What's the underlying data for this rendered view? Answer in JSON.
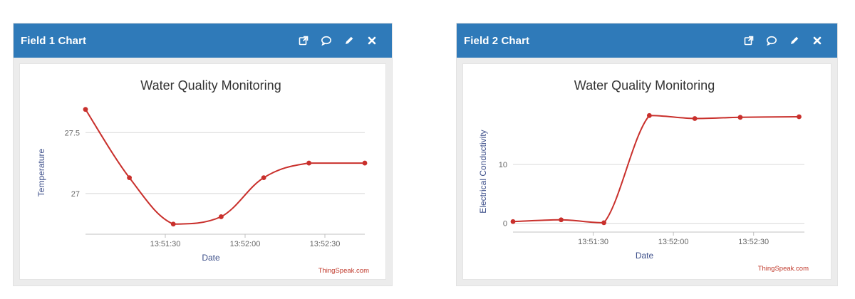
{
  "panels": [
    {
      "title": "Field 1 Chart",
      "tools": [
        "external-link-icon",
        "comment-icon",
        "pencil-icon",
        "close-icon"
      ]
    },
    {
      "title": "Field 2 Chart",
      "tools": [
        "external-link-icon",
        "comment-icon",
        "pencil-icon",
        "close-icon"
      ]
    }
  ],
  "colors": {
    "header": "#2f7ab9",
    "line": "#c9302c",
    "grid": "#d8d8d8"
  },
  "chart_data": [
    {
      "type": "line",
      "title": "Water Quality Monitoring",
      "xlabel": "Date",
      "ylabel": "Temperature",
      "credit": "ThingSpeak.com",
      "x_ticks": [
        "13:51:30",
        "13:52:00",
        "13:52:30"
      ],
      "y_ticks": [
        "27",
        "27.5"
      ],
      "x_tick_values_s": [
        30,
        60,
        90
      ],
      "ylim": [
        26.69,
        27.77
      ],
      "xlim_s": [
        0,
        105
      ],
      "series": [
        {
          "x_s": [
            0,
            16.5,
            33,
            51,
            67,
            84,
            105
          ],
          "values": [
            27.69,
            27.13,
            26.75,
            26.81,
            27.13,
            27.25,
            27.25
          ]
        }
      ],
      "grid": true
    },
    {
      "type": "line",
      "title": "Water Quality Monitoring",
      "xlabel": "Date",
      "ylabel": "Electrical Conductivity",
      "credit": "ThingSpeak.com",
      "x_ticks": [
        "13:51:30",
        "13:52:00",
        "13:52:30"
      ],
      "y_ticks": [
        "0",
        "10"
      ],
      "x_tick_values_s": [
        30,
        60,
        90
      ],
      "ylim": [
        -1.0,
        21.0
      ],
      "xlim_s": [
        0,
        109
      ],
      "series": [
        {
          "x_s": [
            0,
            18,
            34,
            51,
            68,
            85,
            107
          ],
          "values": [
            0.3,
            0.6,
            0.1,
            18.3,
            17.8,
            18.0,
            18.1
          ]
        }
      ],
      "grid": true
    }
  ]
}
